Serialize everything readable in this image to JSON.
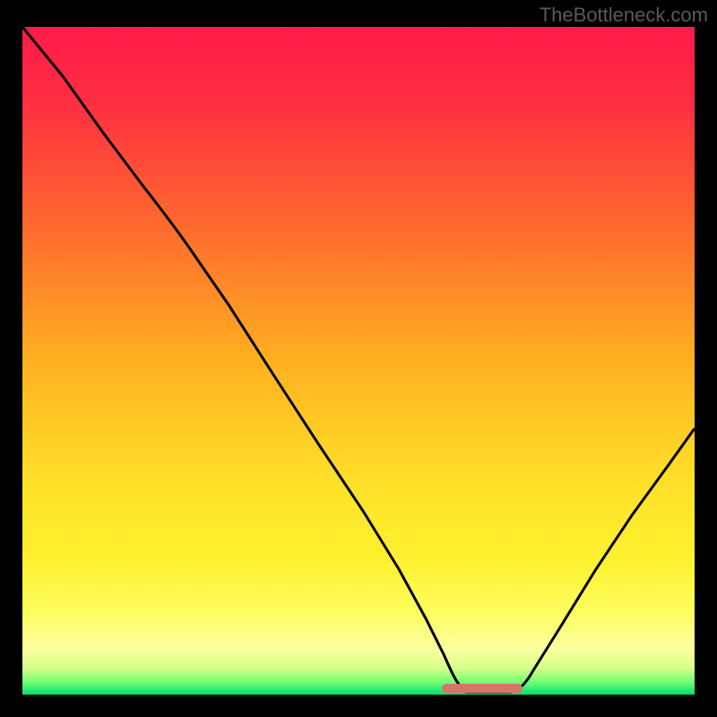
{
  "watermark": "TheBottleneck.com",
  "chart_data": {
    "type": "line",
    "title": "",
    "xlabel": "",
    "ylabel": "",
    "xlim": [
      0,
      100
    ],
    "ylim": [
      0,
      100
    ],
    "x": [
      0,
      5,
      10,
      15,
      20,
      25,
      30,
      35,
      40,
      45,
      50,
      55,
      60,
      62,
      65,
      70,
      73,
      75,
      80,
      85,
      90,
      95,
      100
    ],
    "values": [
      100,
      93,
      85,
      78,
      72,
      67,
      59,
      50,
      42,
      33,
      25,
      17,
      8,
      3,
      0,
      0,
      0,
      2,
      8,
      15,
      22,
      29,
      36
    ],
    "marker_region": {
      "x_start": 63,
      "x_end": 73,
      "y": 0
    },
    "background": {
      "type": "gradient",
      "stops": [
        {
          "pos": 0,
          "color": "#ff1a4a"
        },
        {
          "pos": 50,
          "color": "#ffb020"
        },
        {
          "pos": 75,
          "color": "#fef12f"
        },
        {
          "pos": 90,
          "color": "#fbff8e"
        },
        {
          "pos": 97,
          "color": "#b1ff6a"
        },
        {
          "pos": 100,
          "color": "#00e06e"
        }
      ]
    }
  }
}
